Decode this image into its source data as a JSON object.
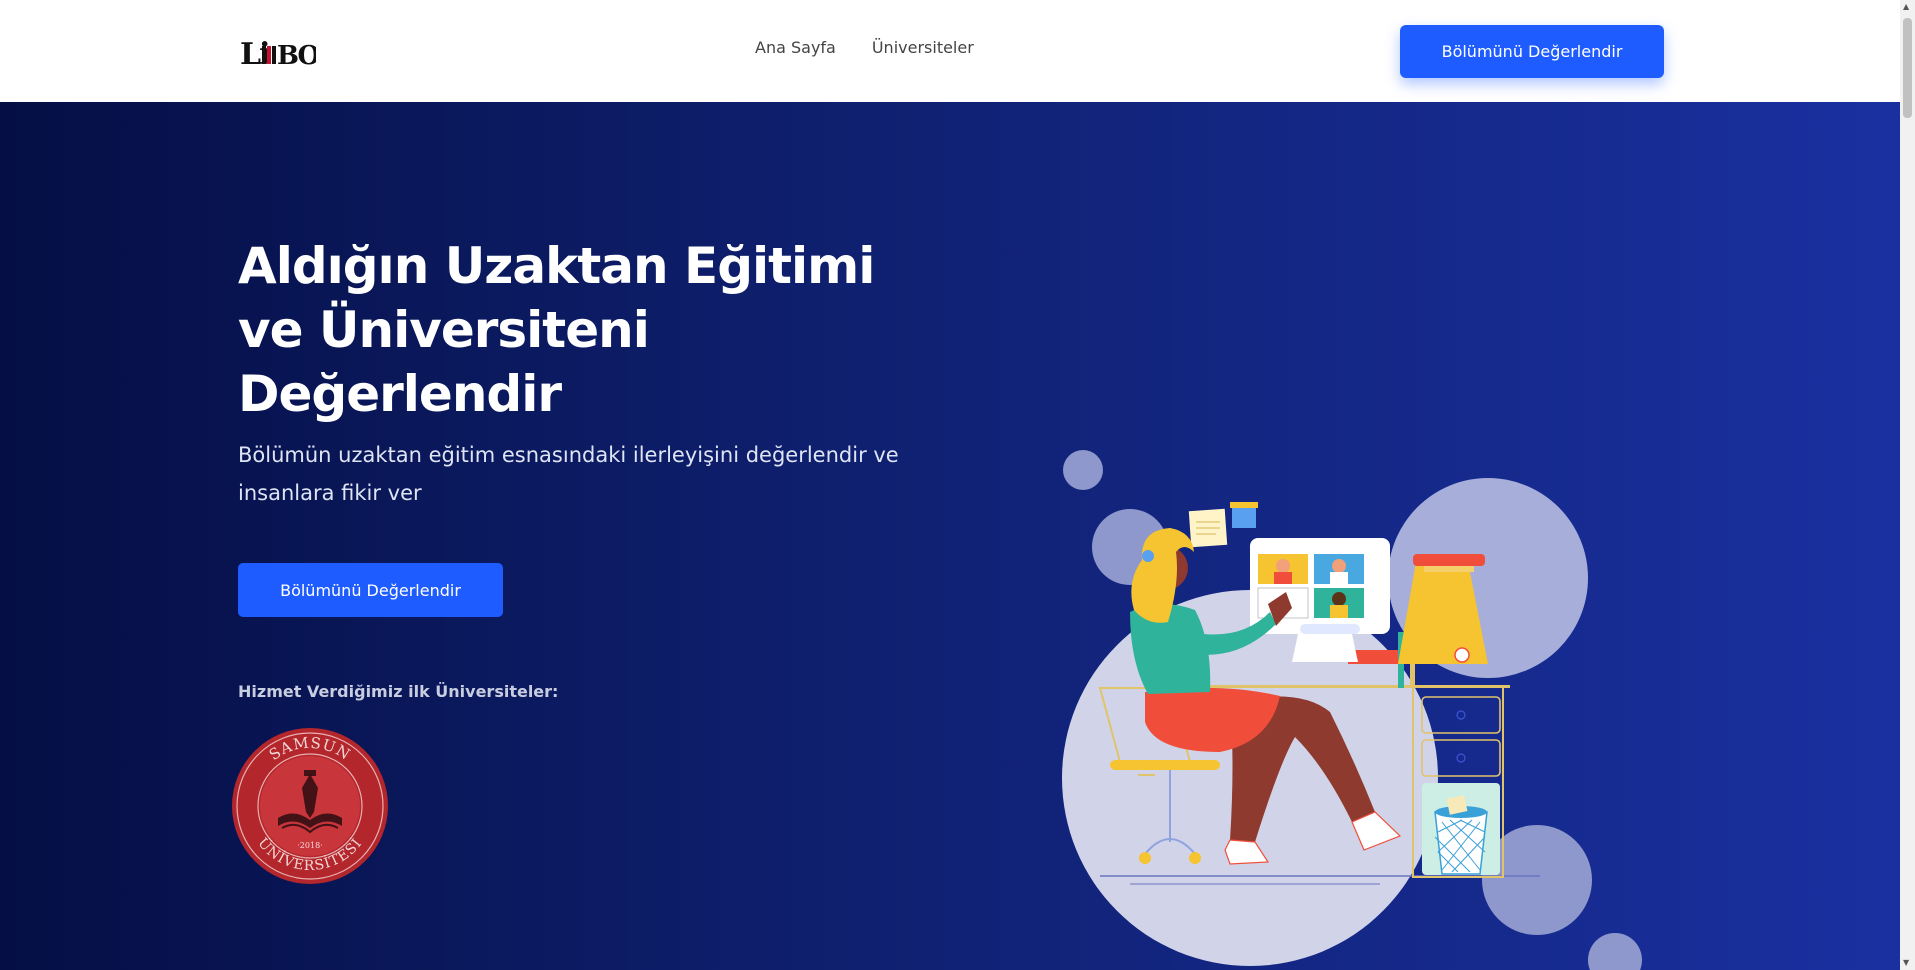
{
  "header": {
    "logo_text": "LIMBO",
    "nav": [
      "Ana Sayfa",
      "Üniversiteler"
    ],
    "cta_label": "Bölümünü Değerlendir"
  },
  "hero": {
    "title": "Aldığın Uzaktan Eğitimi ve Üniversiteni Değerlendir",
    "subtitle": "Bölümün uzaktan eğitim esnasındaki ilerleyişini değerlendir ve insanlara fikir ver",
    "cta_label": "Bölümünü Değerlendir",
    "partners_label": "Hizmet Verdiğimiz ilk Üniversiteler:",
    "partners": [
      {
        "name": "SAMSUN ÜNİVERSİTESİ",
        "year": "2018",
        "color": "#b3262b"
      }
    ]
  },
  "colors": {
    "accent": "#1e5cff",
    "hero_dark": "#050f45",
    "hero_light": "#1a30a0"
  }
}
